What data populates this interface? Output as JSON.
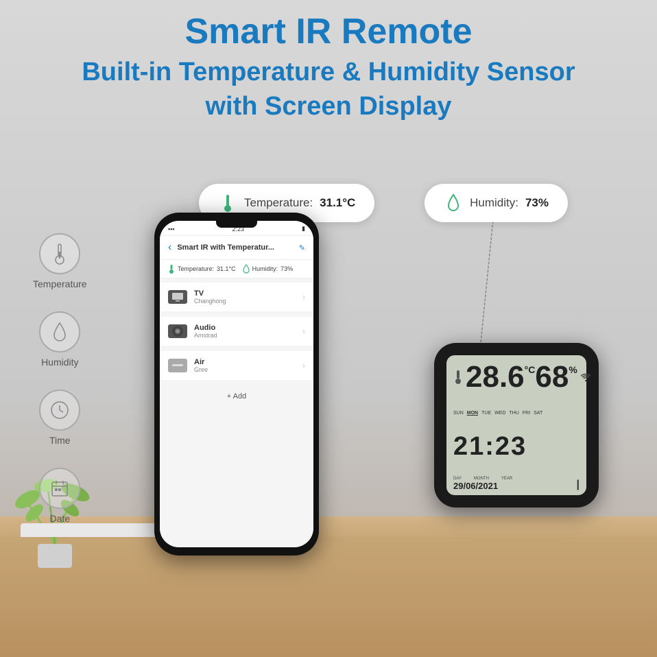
{
  "header": {
    "title": "Smart IR Remote",
    "subtitle_line1": "Built-in Temperature & Humidity Sensor",
    "subtitle_line2": "with Screen Display"
  },
  "callouts": {
    "temperature": {
      "label": "Temperature:",
      "value": "31.1°C"
    },
    "humidity": {
      "label": "Humidity:",
      "value": "73%"
    }
  },
  "sidebar": {
    "items": [
      {
        "label": "Temperature",
        "icon": "thermometer-icon"
      },
      {
        "label": "Humidity",
        "icon": "humidity-icon"
      },
      {
        "label": "Time",
        "icon": "clock-icon"
      },
      {
        "label": "Date",
        "icon": "calendar-icon"
      }
    ]
  },
  "phone": {
    "status_time": "2:23",
    "app_title": "Smart IR with Temperatur...",
    "back_label": "‹",
    "edit_icon": "✎",
    "sensor_temp_label": "Temperature:",
    "sensor_temp_value": "31.1°C",
    "sensor_humid_label": "Humidity:",
    "sensor_humid_value": "73%",
    "list_items": [
      {
        "name": "TV",
        "brand": "Changhong"
      },
      {
        "name": "Audio",
        "brand": "Amstrad"
      },
      {
        "name": "Air",
        "brand": "Gree"
      }
    ],
    "add_label": "+ Add"
  },
  "device": {
    "temperature": "28.6",
    "temp_unit": "°C",
    "humidity": "68",
    "humid_unit": "%",
    "days": [
      "SUN",
      "MON",
      "TUE",
      "WED",
      "THU",
      "FRI",
      "SAT"
    ],
    "active_day": "MON",
    "time": "21:23",
    "date_labels": [
      "DAY",
      "MONTH",
      "YEAR"
    ],
    "date_value": "29/06/2021"
  },
  "colors": {
    "accent_blue": "#1a7abf",
    "green": "#3db87a",
    "teal": "#26a69a"
  }
}
